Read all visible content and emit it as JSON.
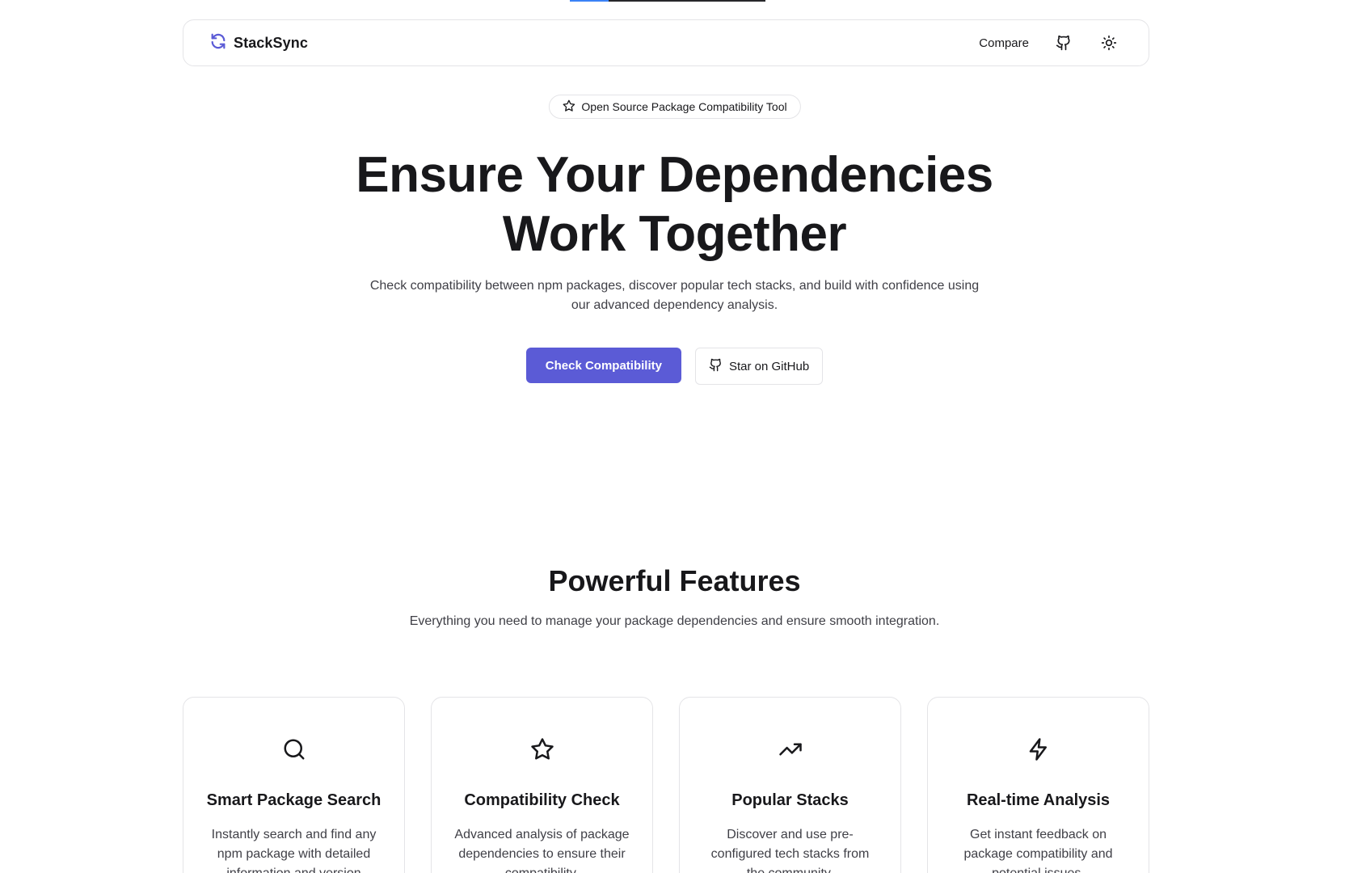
{
  "colors": {
    "primary": "#5b5bd6",
    "text": "#18181b",
    "muted": "#3f3f46",
    "border": "#e4e4e7",
    "progress_track": "#27272a",
    "progress_fill": "#3b82f6"
  },
  "progress": {
    "value_percent": 20
  },
  "nav": {
    "brand": "StackSync",
    "brand_icon": "refresh-icon",
    "links": [
      {
        "label": "Compare"
      }
    ],
    "github_icon": "github-icon",
    "theme_icon": "sun-icon"
  },
  "hero": {
    "badge": {
      "icon": "star-icon",
      "label": "Open Source Package Compatibility Tool"
    },
    "title_line1": "Ensure Your Dependencies",
    "title_line2": "Work Together",
    "subtitle": "Check compatibility between npm packages, discover popular tech stacks, and build with confidence using our advanced dependency analysis.",
    "primary_cta": "Check Compatibility",
    "secondary_cta": "Star on GitHub",
    "secondary_cta_icon": "github-icon"
  },
  "features": {
    "title": "Powerful Features",
    "subtitle": "Everything you need to manage your package dependencies and ensure smooth integration.",
    "items": [
      {
        "icon": "search-icon",
        "title": "Smart Package Search",
        "desc": "Instantly search and find any npm package with detailed information and version history."
      },
      {
        "icon": "star-icon",
        "title": "Compatibility Check",
        "desc": "Advanced analysis of package dependencies to ensure their compatibility."
      },
      {
        "icon": "trending-up-icon",
        "title": "Popular Stacks",
        "desc": "Discover and use pre-configured tech stacks from the community."
      },
      {
        "icon": "zap-icon",
        "title": "Real-time Analysis",
        "desc": "Get instant feedback on package compatibility and potential issues."
      }
    ]
  }
}
